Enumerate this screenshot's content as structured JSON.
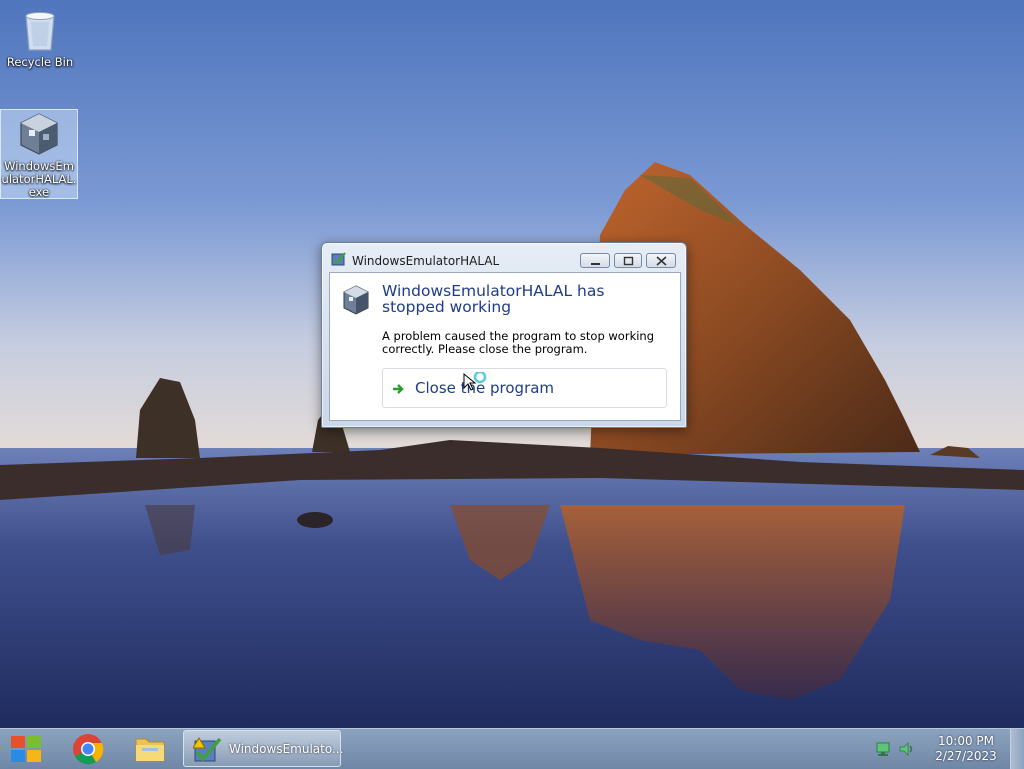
{
  "desktop": {
    "icons": [
      {
        "label": "Recycle Bin",
        "icon": "recycle-bin-icon"
      },
      {
        "label": "WindowsEmulatorHALAL.exe",
        "icon": "virtualbox-cube-icon",
        "selected": true
      }
    ]
  },
  "dialog": {
    "title": "WindowsEmulatorHALAL",
    "heading": "WindowsEmulatorHALAL has stopped working",
    "description": "A problem caused the program to stop working correctly. Please close the program.",
    "action_label": "Close the program",
    "titlebar_buttons": [
      "minimize",
      "maximize",
      "close"
    ]
  },
  "taskbar": {
    "pinned": [
      "start-logo-icon",
      "chrome-icon",
      "file-explorer-icon"
    ],
    "active_task_label": "WindowsEmulato...",
    "tray": {
      "network_icon": "network-icon",
      "volume_icon": "volume-icon"
    },
    "clock": {
      "time": "10:00 PM",
      "date": "2/27/2023"
    }
  },
  "colors": {
    "heading_blue": "#1e3c8a",
    "taskbar": "#7d95b3"
  }
}
